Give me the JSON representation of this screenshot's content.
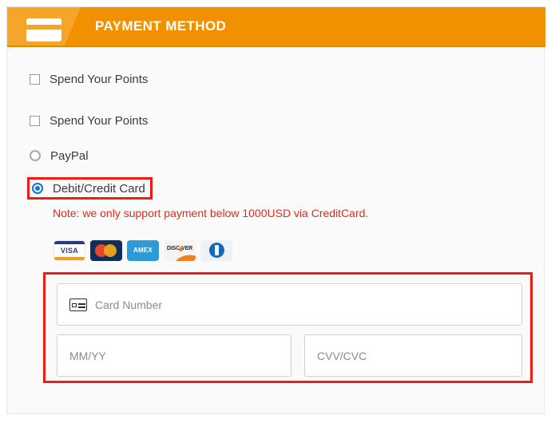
{
  "header": {
    "title": "PAYMENT METHOD",
    "icon": "credit-card-icon",
    "background_color": "#F29100",
    "badge_color": "#F5A529",
    "title_color": "#FFFFFF"
  },
  "options": [
    {
      "type": "checkbox",
      "label": "Spend Your Points",
      "checked": false
    },
    {
      "type": "checkbox",
      "label": "Spend Your Points",
      "checked": false
    },
    {
      "type": "radio",
      "label": "PayPal",
      "checked": false
    },
    {
      "type": "radio",
      "label": "Debit/Credit Card",
      "checked": true,
      "highlighted": true
    }
  ],
  "note": {
    "text": "Note: we only support payment below 1000USD via CreditCard.",
    "color": "#E02B1C"
  },
  "card_brands": [
    {
      "name": "visa-logo",
      "label": "VISA"
    },
    {
      "name": "mastercard-logo",
      "label": ""
    },
    {
      "name": "amex-logo",
      "label": "AMEX"
    },
    {
      "name": "discover-logo",
      "label": "DISC VER"
    },
    {
      "name": "diners-club-logo",
      "label": ""
    }
  ],
  "card_form": {
    "card_number": {
      "placeholder": "Card Number",
      "value": ""
    },
    "expiry": {
      "placeholder": "MM/YY",
      "value": ""
    },
    "cvv": {
      "placeholder": "CVV/CVC",
      "value": ""
    },
    "highlight_color": "#EE1C11"
  }
}
